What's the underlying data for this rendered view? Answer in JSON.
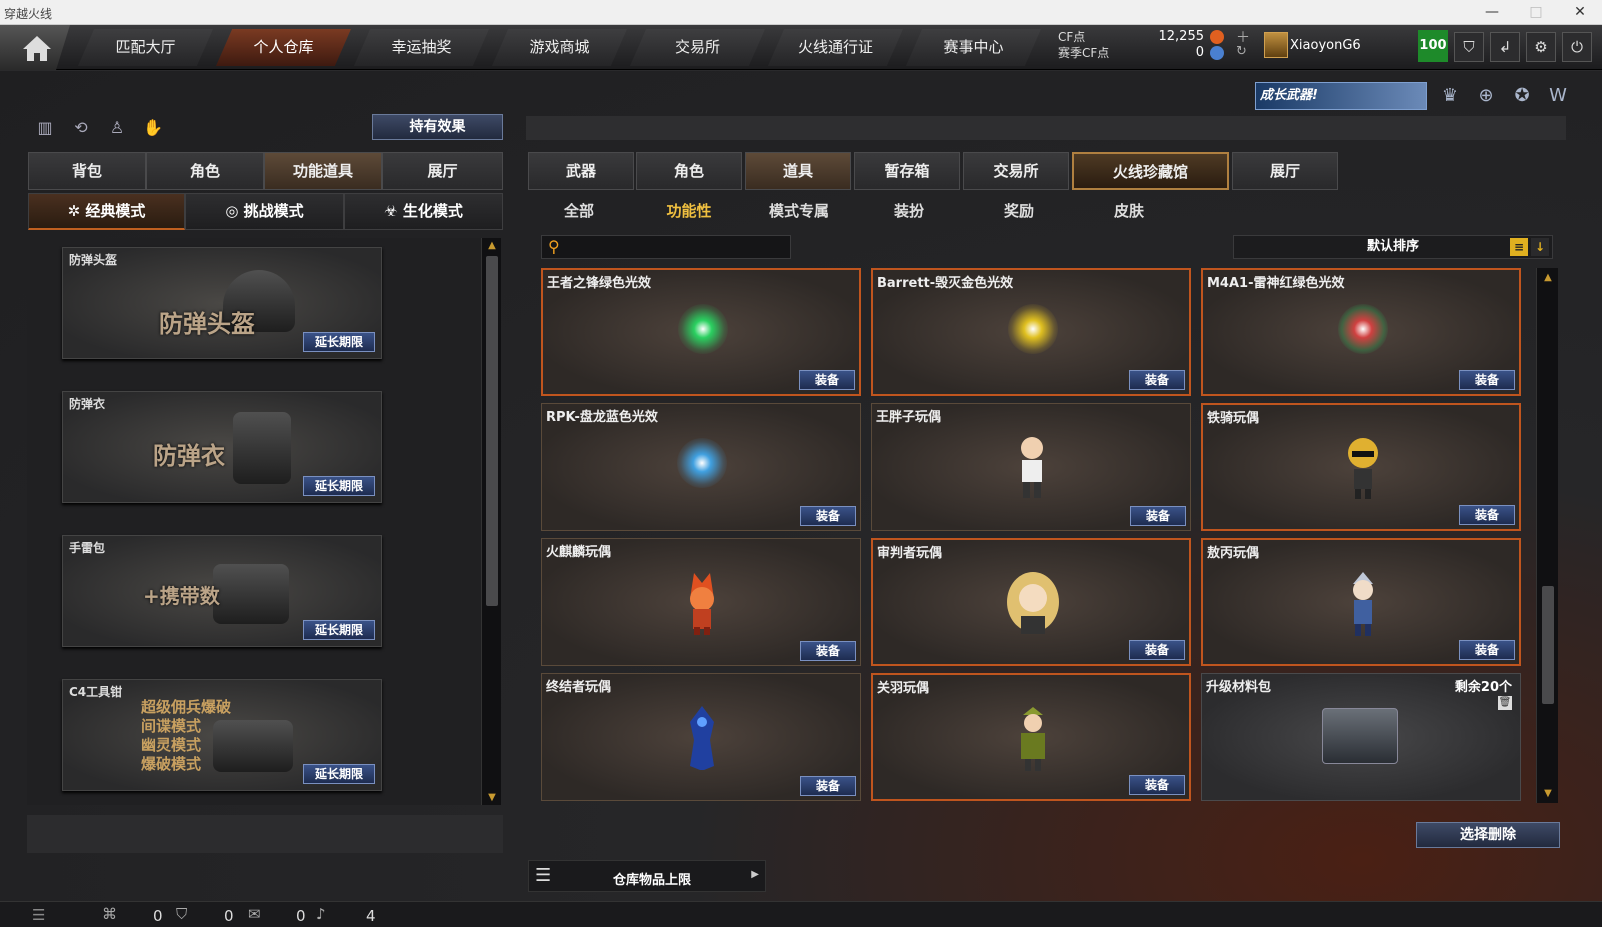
{
  "window": {
    "title": "穿越火线"
  },
  "nav": {
    "tabs": [
      {
        "label": "匹配大厅"
      },
      {
        "label": "个人仓库"
      },
      {
        "label": "幸运抽奖"
      },
      {
        "label": "游戏商城"
      },
      {
        "label": "交易所"
      },
      {
        "label": "火线通行证"
      },
      {
        "label": "赛事中心"
      }
    ],
    "active": "个人仓库"
  },
  "currency": {
    "cf_label": "CF点",
    "cf_value": "12,255",
    "season_label": "赛季CF点",
    "season_value": "0"
  },
  "user": {
    "name": "XiaoyonG6",
    "level": "100"
  },
  "banner": {
    "text": "成长武器!"
  },
  "left": {
    "hold_effect": "持有效果",
    "tabs": [
      "背包",
      "角色",
      "功能道具",
      "展厅"
    ],
    "active_tab": "功能道具",
    "modes": [
      "经典模式",
      "挑战模式",
      "生化模式"
    ],
    "active_mode": "经典模式",
    "items": [
      {
        "name": "防弹头盔",
        "art": "防弹头盔",
        "button": "延长期限"
      },
      {
        "name": "防弹衣",
        "art": "防弹衣",
        "button": "延长期限"
      },
      {
        "name": "手雷包",
        "art": "+携带数",
        "button": "延长期限"
      },
      {
        "name": "C4工具钳",
        "art": [
          "超级佣兵爆破",
          "间谍模式",
          "幽灵模式",
          "爆破模式"
        ],
        "button": "延长期限"
      }
    ]
  },
  "right": {
    "tabs": [
      "武器",
      "角色",
      "道具",
      "暂存箱",
      "交易所",
      "火线珍藏馆",
      "展厅"
    ],
    "active_tab": "道具",
    "special_tab": "火线珍藏馆",
    "subtabs": [
      "全部",
      "功能性",
      "模式专属",
      "装扮",
      "奖励",
      "皮肤"
    ],
    "active_subtab": "功能性",
    "sort": "默认排序",
    "cards": [
      {
        "name": "王者之锋绿色光效",
        "button": "装备",
        "color": "#2ad060"
      },
      {
        "name": "Barrett-毁灭金色光效",
        "button": "装备",
        "color": "#e0c020"
      },
      {
        "name": "M4A1-雷神红绿色光效",
        "button": "装备",
        "color": "#d04040"
      },
      {
        "name": "RPK-盘龙蓝色光效",
        "button": "装备",
        "color": "#40a0e0"
      },
      {
        "name": "王胖子玩偶",
        "button": "装备",
        "color": "#8a6a50"
      },
      {
        "name": "铁骑玩偶",
        "button": "装备",
        "color": "#e0b030"
      },
      {
        "name": "火麒麟玩偶",
        "button": "装备",
        "color": "#e05020"
      },
      {
        "name": "审判者玩偶",
        "button": "装备",
        "color": "#e0c070"
      },
      {
        "name": "敖丙玩偶",
        "button": "装备",
        "color": "#6080c0"
      },
      {
        "name": "终结者玩偶",
        "button": "装备",
        "color": "#2040a0"
      },
      {
        "name": "关羽玩偶",
        "button": "装备",
        "color": "#8a9a30"
      },
      {
        "name": "升级材料包",
        "remaining": "剩余20个",
        "color": "#555"
      }
    ],
    "delete": "选择删除",
    "storage": "仓库物品上限"
  },
  "bottom": {
    "v1": "0",
    "v2": "0",
    "v3": "0",
    "v4": "4"
  }
}
